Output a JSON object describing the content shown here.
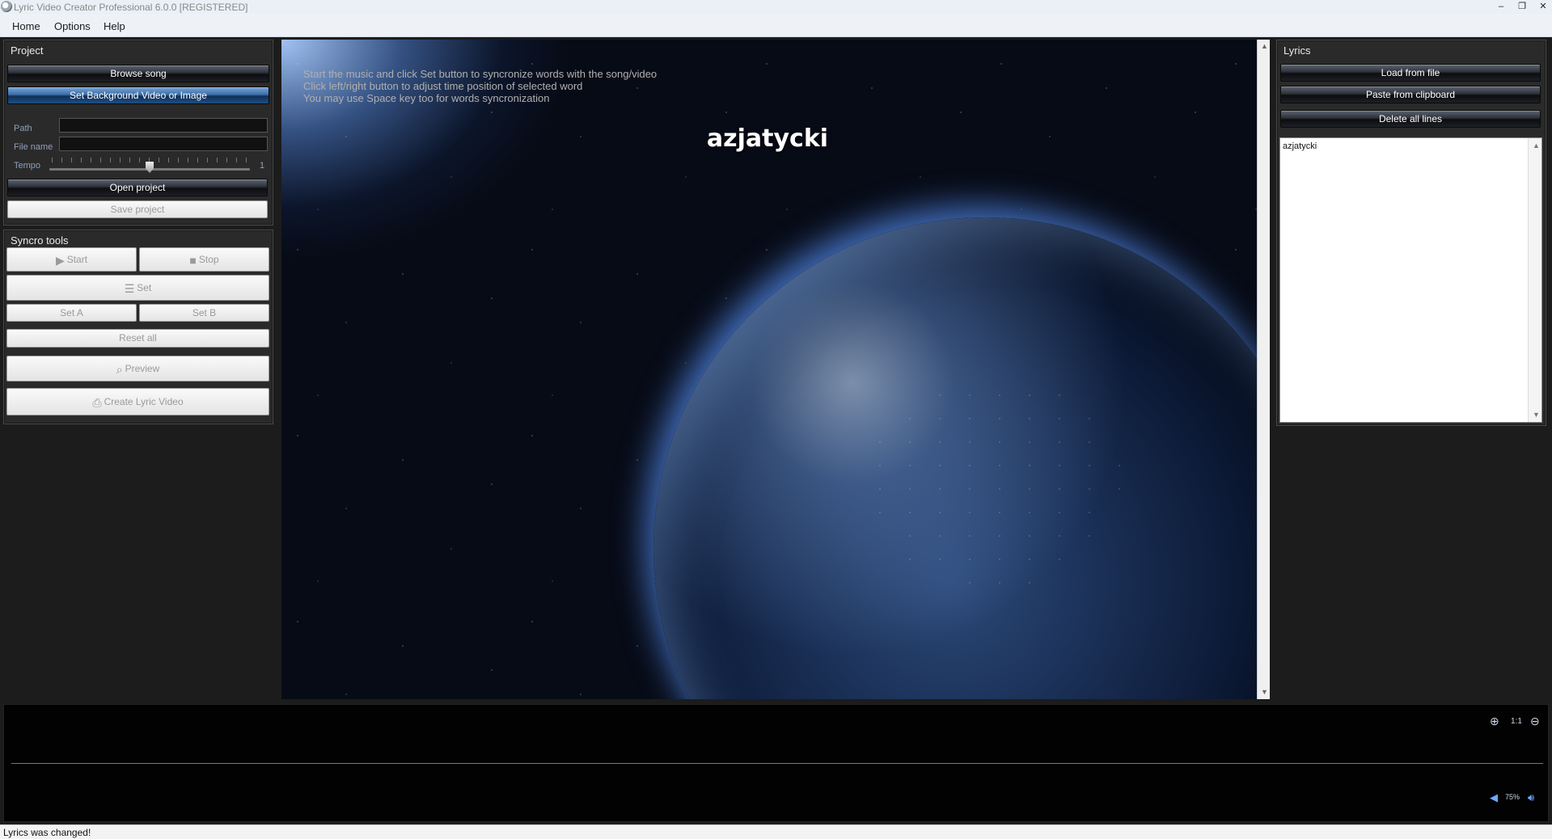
{
  "window": {
    "title": "Lyric Video Creator Professional 6.0.0 [REGISTERED]",
    "minimize": "–",
    "restore": "❐",
    "close": "✕"
  },
  "menu": {
    "home": "Home",
    "options": "Options",
    "help": "Help"
  },
  "project": {
    "title": "Project",
    "browse_song": "Browse song",
    "set_background": "Set Background Video or Image",
    "path_label": "Path",
    "path_value": "",
    "filename_label": "File name",
    "filename_value": "",
    "tempo_label": "Tempo",
    "tempo_value": "1",
    "open_project": "Open project",
    "save_project": "Save project"
  },
  "syncro": {
    "title": "Syncro tools",
    "start": "Start",
    "stop": "Stop",
    "set": "Set",
    "set_a": "Set A",
    "set_b": "Set B",
    "reset_all": "Reset all",
    "preview": "Preview",
    "create_video": "Create Lyric Video"
  },
  "preview": {
    "hints": [
      "Start the music and click Set button to syncronize words with the song/video",
      "Click left/right button to adjust time position of selected word",
      "You may use Space key too for words syncronization"
    ],
    "current_lyric": "azjatycki"
  },
  "lyrics": {
    "title": "Lyrics",
    "load_from_file": "Load from file",
    "paste_from_clipboard": "Paste from clipboard",
    "delete_all_lines": "Delete all lines",
    "lines": [
      "azjatycki"
    ]
  },
  "timeline": {
    "zoom_ratio": "1:1",
    "volume": "75%"
  },
  "status": {
    "message": "Lyrics was changed!"
  },
  "icons": {
    "zoom_in": "zoom-in-icon",
    "zoom_out": "zoom-out-icon",
    "volume": "speaker-icon",
    "play": "play-icon",
    "stop": "stop-icon"
  },
  "colors": {
    "panel_bg": "#2a2a2a",
    "accent_blue": "#3c6ea8",
    "timeline_bg": "#020202"
  }
}
